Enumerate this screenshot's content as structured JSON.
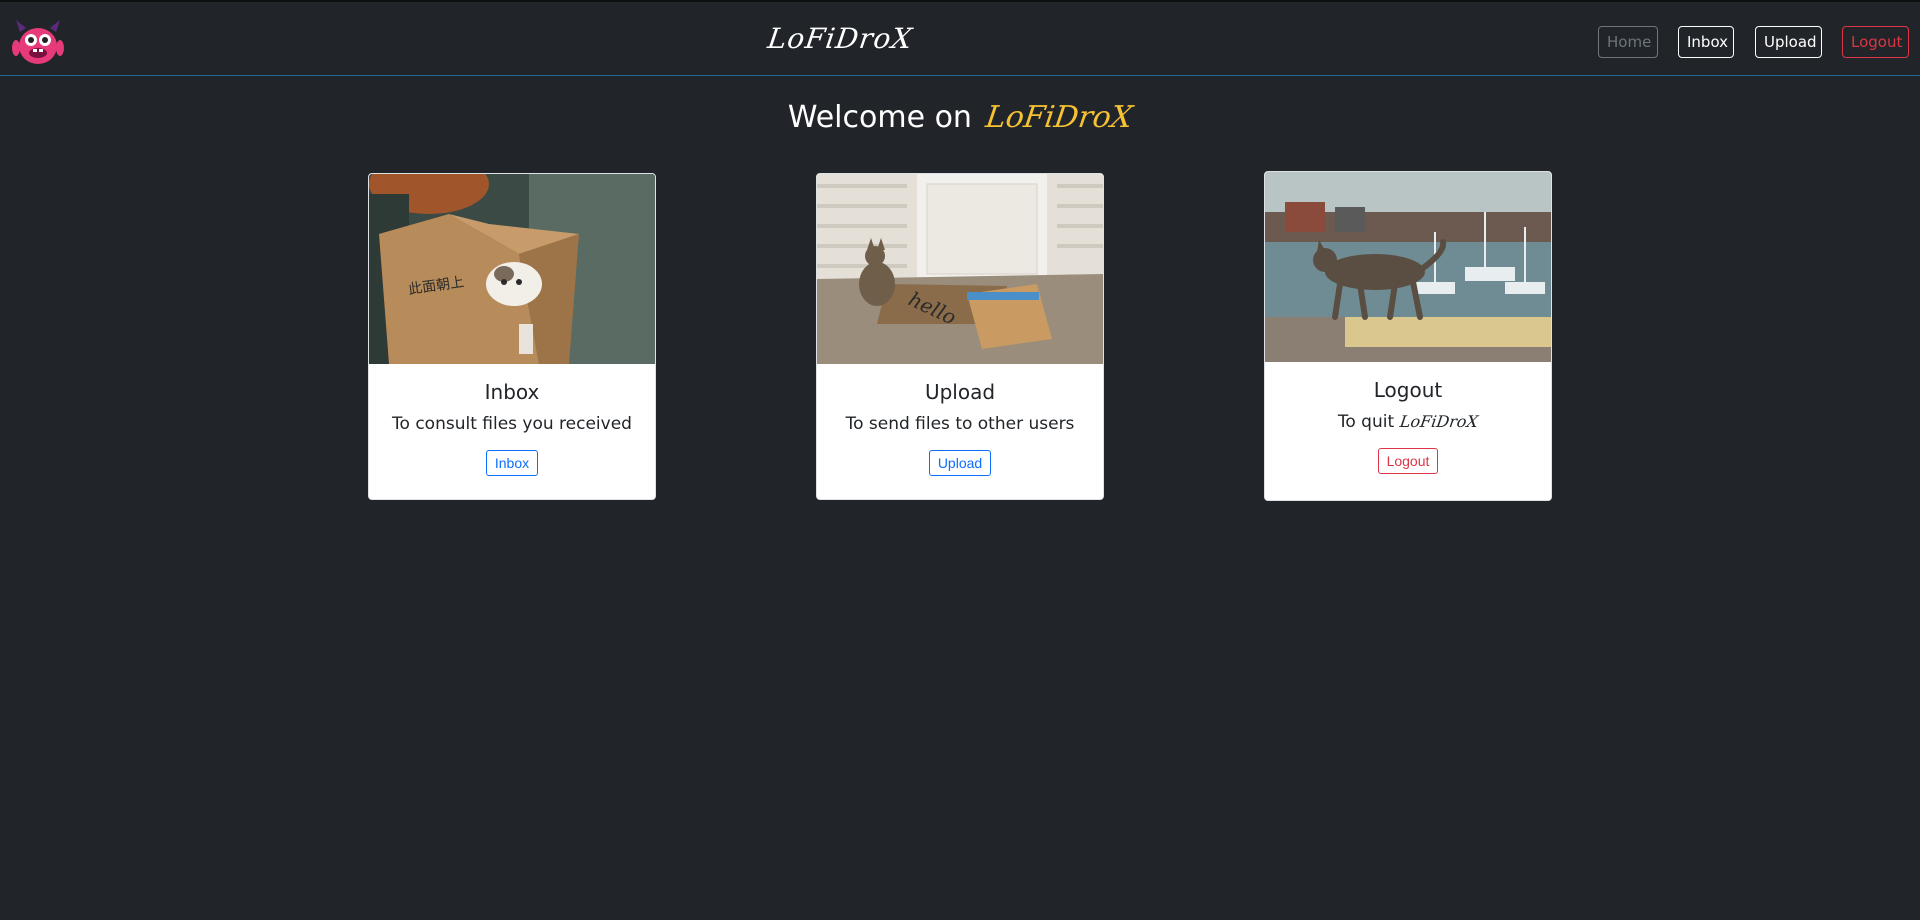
{
  "header": {
    "brand": "LoFiDroX",
    "nav": {
      "home": "Home",
      "inbox": "Inbox",
      "upload": "Upload",
      "logout": "Logout"
    }
  },
  "main": {
    "welcome_text": "Welcome on",
    "welcome_brand": "LoFiDroX",
    "cards": [
      {
        "title": "Inbox",
        "text": "To consult files you received",
        "button": "Inbox"
      },
      {
        "title": "Upload",
        "text": "To send files to other users",
        "button": "Upload"
      },
      {
        "title": "Logout",
        "text": "To quit",
        "text_brand": "LoFiDroX",
        "button": "Logout"
      }
    ]
  },
  "colors": {
    "background": "#212529",
    "brand_accent": "#f6c234",
    "primary": "#0d6efd",
    "danger": "#dc3545",
    "secondary": "#6c757d"
  },
  "icons": {
    "logo": "pink-monster-logo"
  }
}
